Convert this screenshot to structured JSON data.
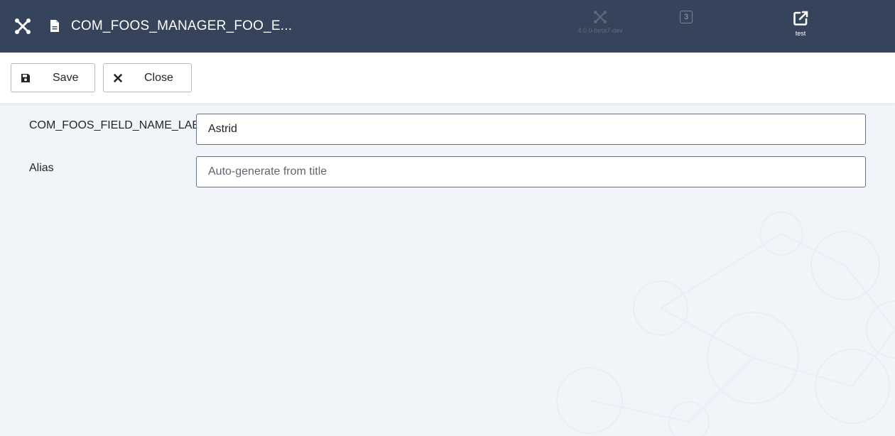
{
  "header": {
    "title": "COM_FOOS_MANAGER_FOO_E...",
    "version_caption": "4.0.0-beta7-dev",
    "badge_count": "3",
    "site_caption": "test",
    "background": "#35445a"
  },
  "toolbar": {
    "save_label": "Save",
    "close_label": "Close"
  },
  "form": {
    "name_label": "COM_FOOS_FIELD_NAME_LABEL",
    "name_value": "Astrid",
    "alias_label": "Alias",
    "alias_value": "",
    "alias_placeholder": "Auto-generate from title"
  },
  "icons": {
    "logo": "joomla-logo-icon",
    "document": "document-icon",
    "version": "joomla-version-icon",
    "badge": "notification-badge",
    "site": "external-link-icon",
    "save": "save-icon",
    "close": "close-icon"
  }
}
